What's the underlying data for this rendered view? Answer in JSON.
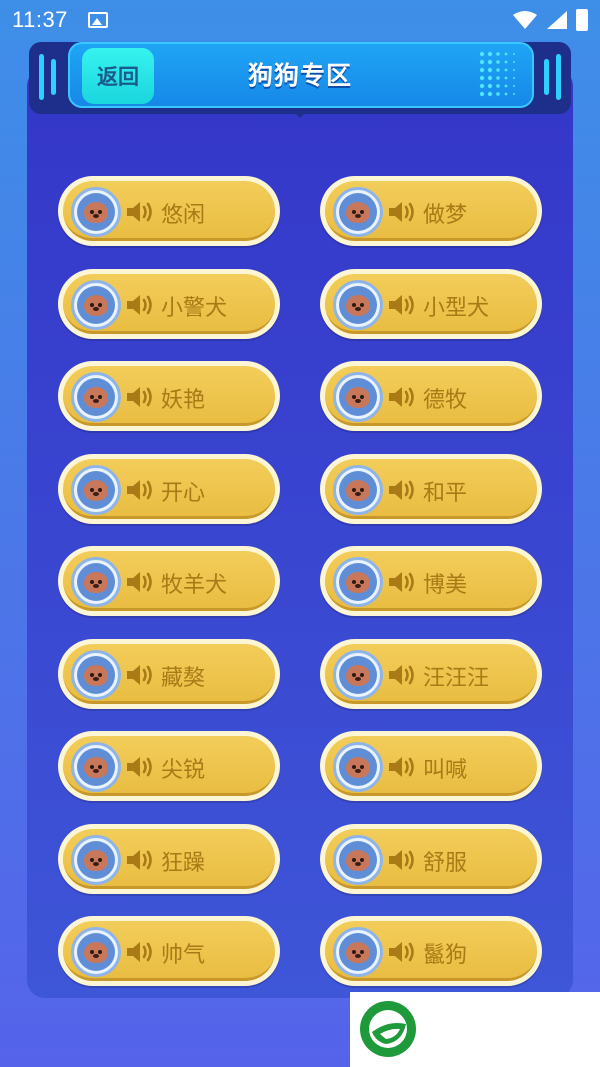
{
  "status_bar": {
    "time": "11:37"
  },
  "header": {
    "back_label": "返回",
    "title": "狗狗专区"
  },
  "sounds": [
    {
      "label": "悠闲"
    },
    {
      "label": "做梦"
    },
    {
      "label": "小警犬"
    },
    {
      "label": "小型犬"
    },
    {
      "label": "妖艳"
    },
    {
      "label": "德牧"
    },
    {
      "label": "开心"
    },
    {
      "label": "和平"
    },
    {
      "label": "牧羊犬"
    },
    {
      "label": "博美"
    },
    {
      "label": "藏獒"
    },
    {
      "label": "汪汪汪"
    },
    {
      "label": "尖锐"
    },
    {
      "label": "叫喊"
    },
    {
      "label": "狂躁"
    },
    {
      "label": "舒服"
    },
    {
      "label": "帅气"
    },
    {
      "label": "鬣狗"
    }
  ],
  "icons": {
    "speaker": "speaker-icon",
    "avatar": "dog-avatar-icon",
    "ad_logo": "green-g-logo-icon"
  },
  "colors": {
    "accent": "#1fa5f5",
    "button_fill": "#f3cd5a",
    "button_text": "#a97a16",
    "back_button": "#37f3ee"
  }
}
